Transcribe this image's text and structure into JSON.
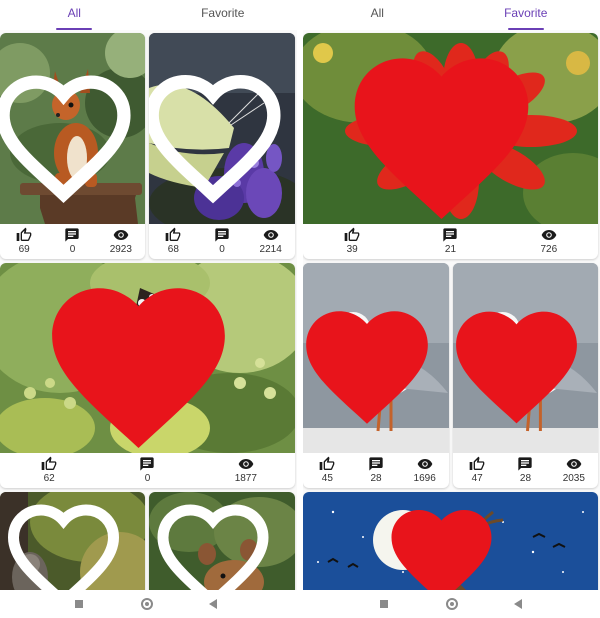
{
  "left_screen": {
    "tabs": [
      {
        "label": "All",
        "active": true
      },
      {
        "label": "Favorite",
        "active": false
      }
    ],
    "cards": [
      {
        "subject": "squirrel",
        "favorite": false,
        "likes": "69",
        "comments": "0",
        "views": "2923"
      },
      {
        "subject": "butterfly-lavender",
        "favorite": false,
        "likes": "68",
        "comments": "0",
        "views": "2214"
      },
      {
        "subject": "red-admiral-butterfly",
        "favorite": true,
        "likes": "62",
        "comments": "0",
        "views": "1877"
      },
      {
        "subject": "squirrel-on-tree",
        "favorite": false
      },
      {
        "subject": "mouse",
        "favorite": false
      }
    ]
  },
  "right_screen": {
    "tabs": [
      {
        "label": "All",
        "active": false
      },
      {
        "label": "Favorite",
        "active": true
      }
    ],
    "cards": [
      {
        "subject": "red-zinnia-flower",
        "favorite": true,
        "likes": "39",
        "comments": "21",
        "views": "726"
      },
      {
        "subject": "seagull",
        "favorite": true,
        "likes": "45",
        "comments": "28",
        "views": "1696"
      },
      {
        "subject": "seagull",
        "favorite": true,
        "likes": "47",
        "comments": "28",
        "views": "2035"
      },
      {
        "subject": "moon-night-tree",
        "favorite": true
      }
    ]
  },
  "icons": {
    "like": "thumb-up-icon",
    "comment": "comment-icon",
    "views": "eye-icon",
    "favorite": "heart-icon"
  },
  "colors": {
    "accent": "#6a3fb5",
    "favorite": "#e8141b"
  }
}
